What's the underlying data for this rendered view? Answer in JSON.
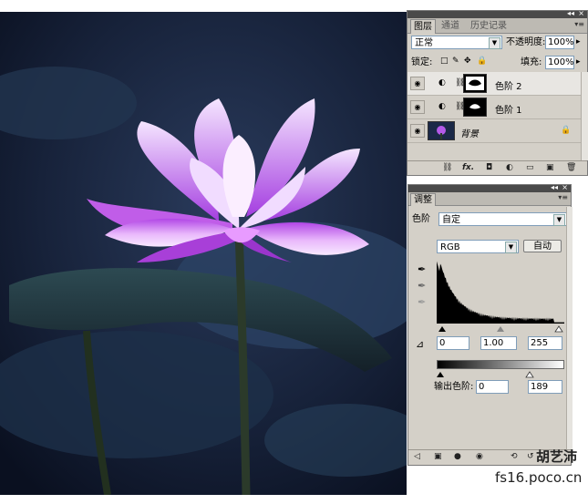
{
  "layers_panel": {
    "tabs": [
      "图层",
      "通道",
      "历史记录"
    ],
    "blend_mode": "正常",
    "opacity_label": "不透明度:",
    "opacity_value": "100%",
    "lock_label": "锁定:",
    "fill_label": "填充:",
    "fill_value": "100%",
    "layers": [
      {
        "name": "色阶 2",
        "selected": true
      },
      {
        "name": "色阶 1",
        "selected": false
      },
      {
        "name": "背景",
        "selected": false,
        "locked": true
      }
    ],
    "footer_icons": [
      "link-icon",
      "fx-icon",
      "mask-icon",
      "adjustment-icon",
      "group-icon",
      "new-layer-icon",
      "trash-icon"
    ],
    "footer_fx": "fx."
  },
  "adjustments_panel": {
    "title": "调整",
    "preset_label": "色阶",
    "preset_value": "自定",
    "channel_value": "RGB",
    "auto_label": "自动",
    "input_black": "0",
    "input_gamma": "1.00",
    "input_white": "255",
    "output_label": "输出色阶:",
    "output_black": "0",
    "output_white": "189"
  },
  "watermark": {
    "line1": "胡艺沛",
    "line2": "fs16.poco.cn"
  },
  "colors": {
    "panel_bg": "#d4d0c8",
    "title_bar": "#4a4a4a",
    "lotus_pink": "#d35cf0",
    "night_blue": "#1e2c4a"
  }
}
